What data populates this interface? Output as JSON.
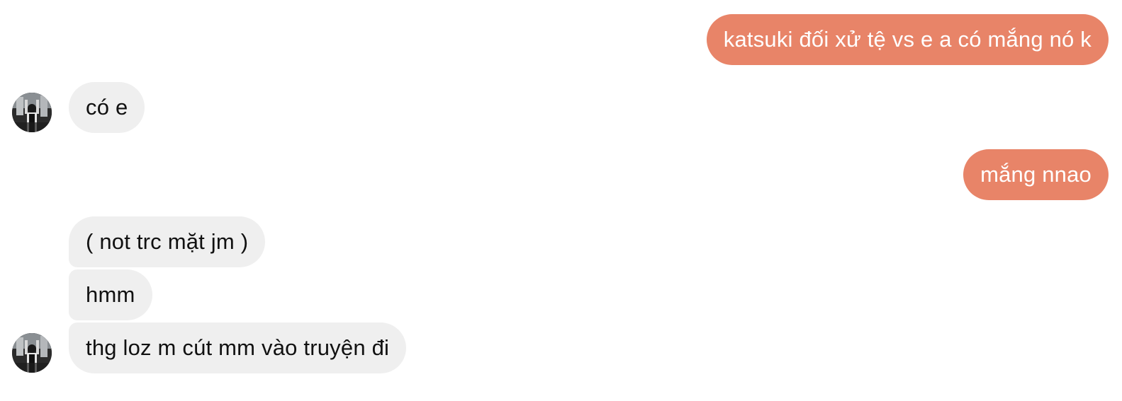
{
  "colors": {
    "outgoing_bubble": "#e88468",
    "incoming_bubble": "#efefef",
    "outgoing_text": "#ffffff",
    "incoming_text": "#111111",
    "background": "#ffffff"
  },
  "messages": [
    {
      "from": "me",
      "text": "katsuki đối xử tệ vs e a có mắng nó k"
    },
    {
      "from": "them",
      "text": "có e"
    },
    {
      "from": "me",
      "text": "mắng nnao"
    },
    {
      "from": "them",
      "text": "( not trc mặt jm )"
    },
    {
      "from": "them",
      "text": "hmm"
    },
    {
      "from": "them",
      "text": "thg loz m cút mm vào truyện đi"
    }
  ],
  "contact": {
    "avatar_icon": "profile-photo-avatar"
  }
}
